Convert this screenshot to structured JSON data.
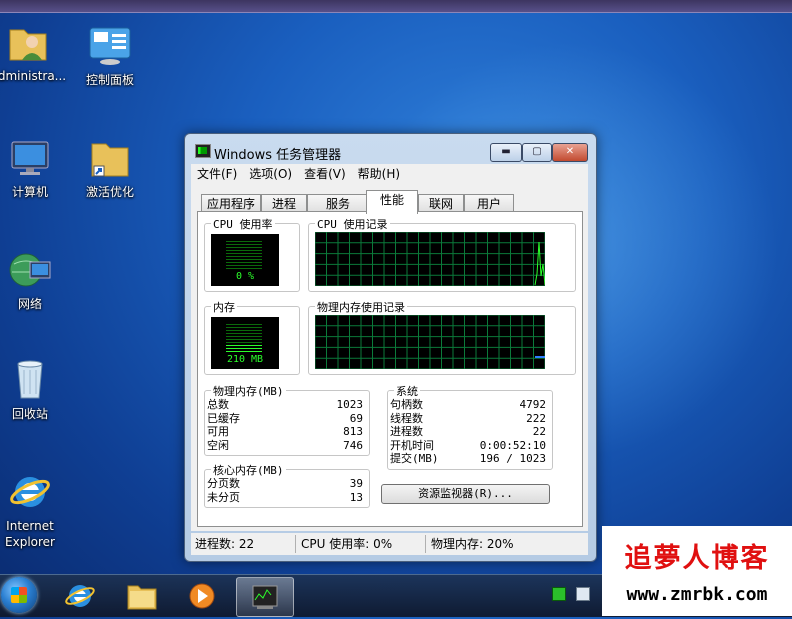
{
  "desktop": {
    "icons": [
      {
        "label": "Administra..."
      },
      {
        "label": "控制面板"
      },
      {
        "label": "计算机"
      },
      {
        "label": "激活优化"
      },
      {
        "label": "网络"
      },
      {
        "label": "回收站"
      },
      {
        "label": "Internet Explorer"
      }
    ]
  },
  "window": {
    "title": "Windows 任务管理器",
    "buttons": {
      "minimize": "▬",
      "maximize": "▢",
      "close": "✕"
    },
    "menu": [
      "文件(F)",
      "选项(O)",
      "查看(V)",
      "帮助(H)"
    ],
    "tabs": [
      "应用程序",
      "进程",
      "服务",
      "性能",
      "联网",
      "用户"
    ],
    "active_tab": "性能",
    "performance": {
      "cpu_usage": {
        "label": "CPU 使用率",
        "value": "0 %"
      },
      "cpu_history": {
        "label": "CPU 使用记录"
      },
      "memory": {
        "label": "内存",
        "value": "210 MB"
      },
      "memory_history": {
        "label": "物理内存使用记录"
      },
      "physical_memory": {
        "label": "物理内存(MB)",
        "rows": [
          {
            "k": "总数",
            "v": "1023"
          },
          {
            "k": "已缓存",
            "v": "69"
          },
          {
            "k": "可用",
            "v": "813"
          },
          {
            "k": "空闲",
            "v": "746"
          }
        ]
      },
      "kernel_memory": {
        "label": "核心内存(MB)",
        "rows": [
          {
            "k": "分页数",
            "v": "39"
          },
          {
            "k": "未分页",
            "v": "13"
          }
        ]
      },
      "system": {
        "label": "系统",
        "rows": [
          {
            "k": "句柄数",
            "v": "4792"
          },
          {
            "k": "线程数",
            "v": "222"
          },
          {
            "k": "进程数",
            "v": "22"
          },
          {
            "k": "开机时间",
            "v": "0:00:52:10"
          },
          {
            "k": "提交(MB)",
            "v": "196 / 1023"
          }
        ]
      },
      "resource_monitor_button": "资源监视器(R)..."
    },
    "status": {
      "processes": "进程数: 22",
      "cpu": "CPU 使用率: 0%",
      "memory": "物理内存: 20%"
    }
  },
  "watermark": {
    "line1": "追夢人博客",
    "line2": "www.zmrbk.com"
  },
  "colors": {
    "graph_grid": "#0b7a3a",
    "graph_line": "#2bff2b",
    "mem_line": "#2f7fff"
  }
}
